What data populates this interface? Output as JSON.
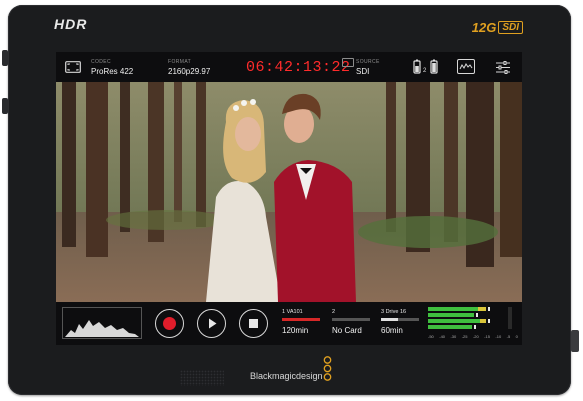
{
  "device": {
    "hdr_logo": "HDR",
    "sdi_logo_prefix": "12G",
    "sdi_logo_box": "SDI",
    "brand": "Blackmagicdesign"
  },
  "topbar": {
    "codec": {
      "label": "CODEC",
      "value": "ProRes 422"
    },
    "format": {
      "label": "FORMAT",
      "value": "2160p29.97"
    },
    "timecode": "06:42:13:22",
    "source": {
      "label": "SOURCE",
      "value": "SDI"
    },
    "battery_index": "2"
  },
  "bottombar": {
    "slots": [
      {
        "name": "1  VA101",
        "time": "120min",
        "fill": 1.0,
        "color": "#d62828"
      },
      {
        "name": "2",
        "time": "No Card",
        "fill": 0.0,
        "color": "#555555"
      },
      {
        "name": "3  Drive 16",
        "time": "60min",
        "fill": 0.45,
        "color": "#e0e0e0"
      }
    ],
    "meter_scale": [
      "-50",
      "-40",
      "-30",
      "-25",
      "-20",
      "-15",
      "-10",
      "-5",
      "0"
    ]
  },
  "colors": {
    "accent_red": "#ff2b2b",
    "record_red": "#e11d2b",
    "meter_green": "#3fbf3f",
    "brand_orange": "#e0a020"
  }
}
